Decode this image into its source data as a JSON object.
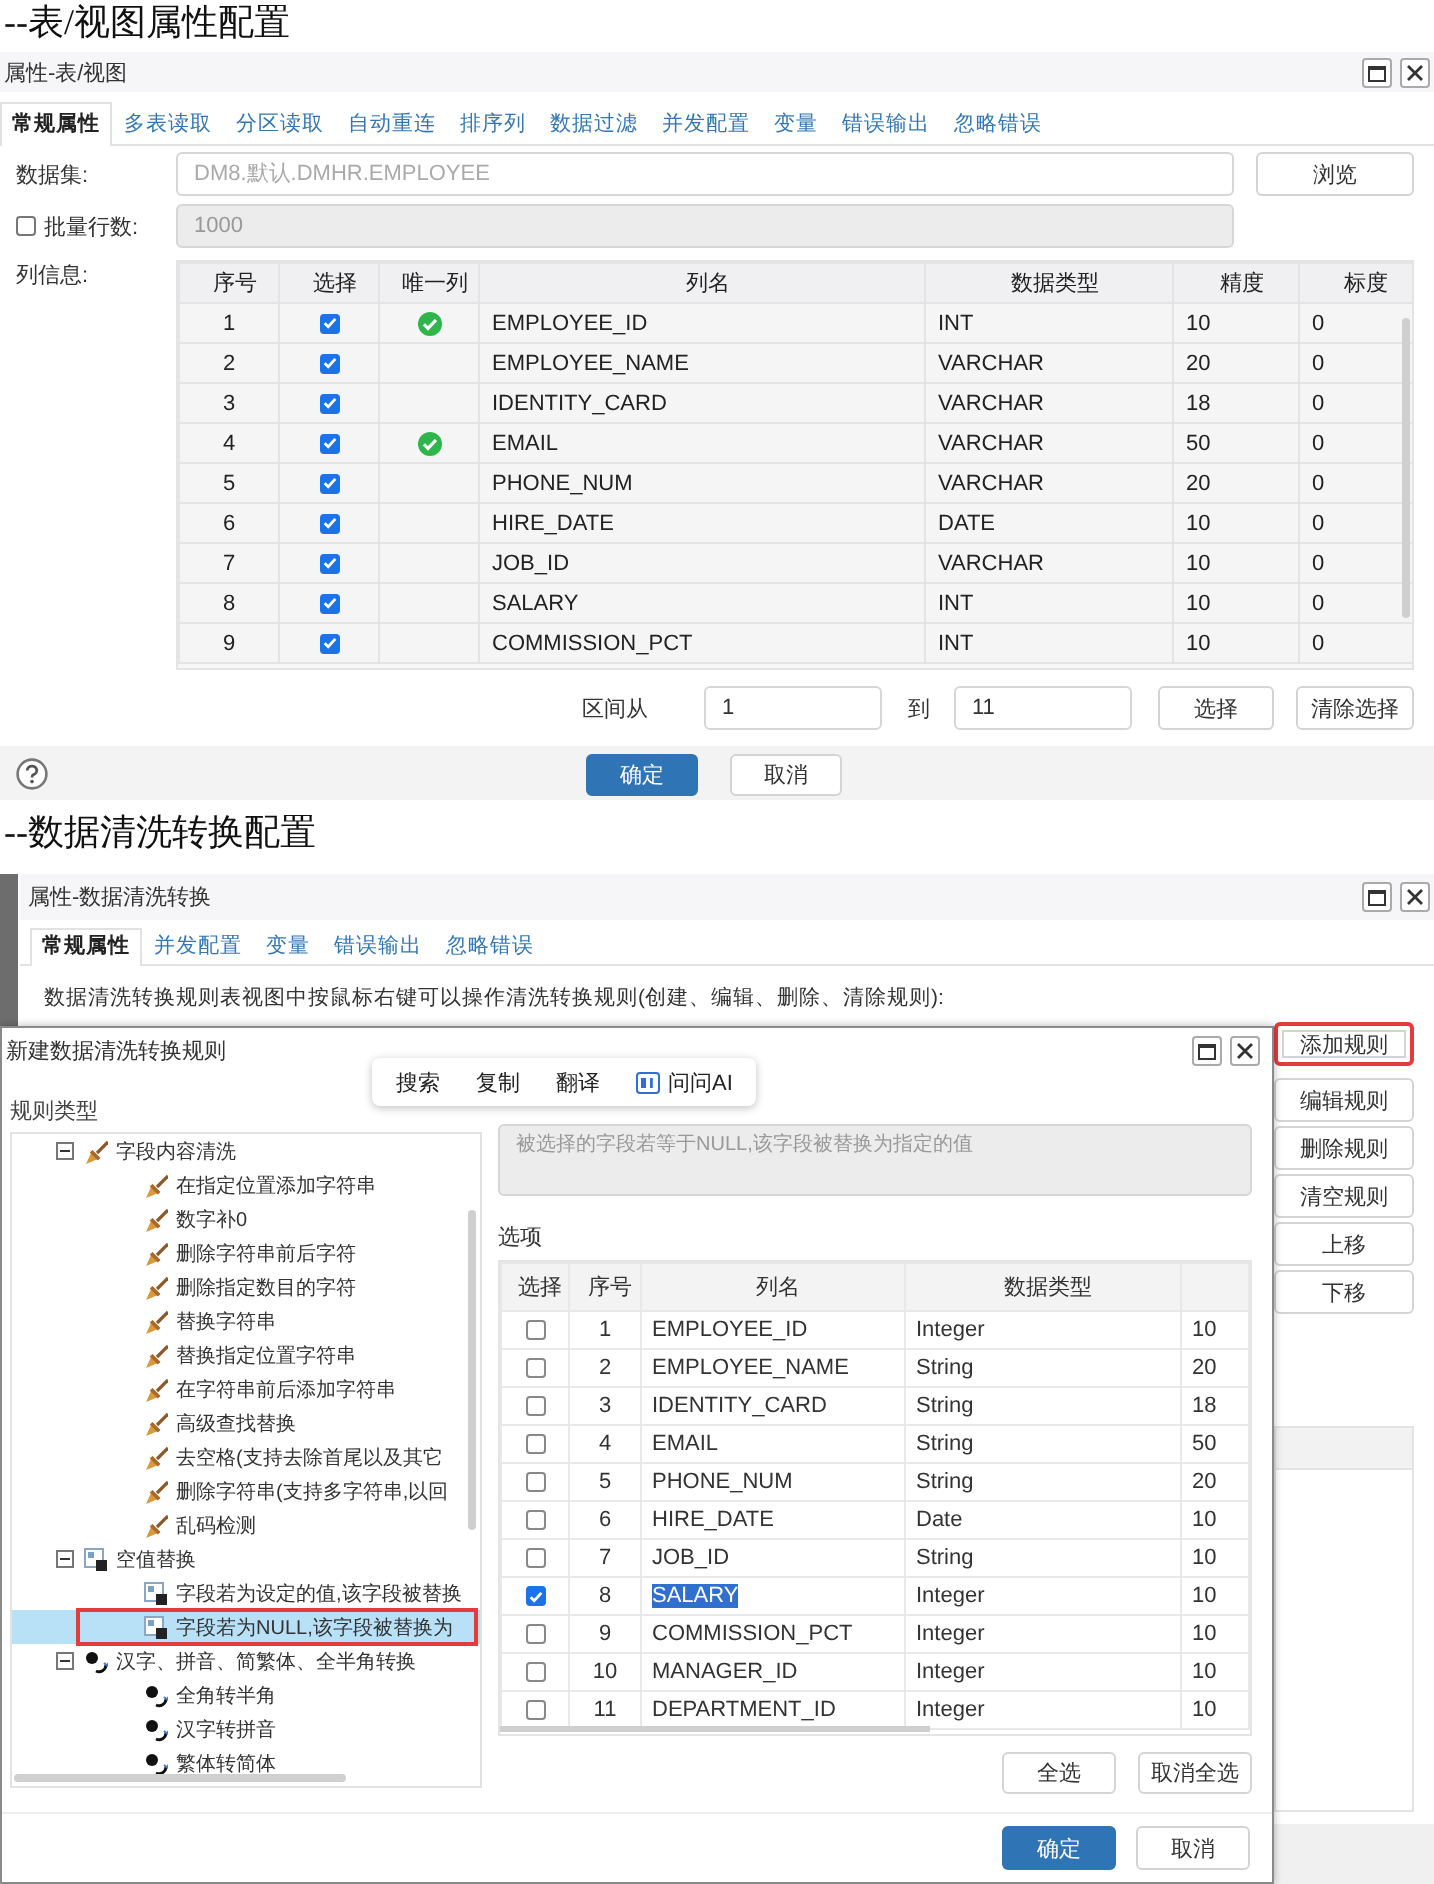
{
  "heading_1": "--表/视图属性配置",
  "table_view_dialog": {
    "title": "属性-表/视图",
    "tabs": [
      {
        "label": "常规属性",
        "selected": true
      },
      {
        "label": "多表读取",
        "selected": false
      },
      {
        "label": "分区读取",
        "selected": false
      },
      {
        "label": "自动重连",
        "selected": false
      },
      {
        "label": "排序列",
        "selected": false
      },
      {
        "label": "数据过滤",
        "selected": false
      },
      {
        "label": "并发配置",
        "selected": false
      },
      {
        "label": "变量",
        "selected": false
      },
      {
        "label": "错误输出",
        "selected": false
      },
      {
        "label": "忽略错误",
        "selected": false
      }
    ],
    "dataset": {
      "label": "数据集:",
      "value": "DM8.默认.DMHR.EMPLOYEE"
    },
    "browse_button": "浏览",
    "batch_rows": {
      "label": "批量行数:",
      "checked": false,
      "value": "1000",
      "disabled": true
    },
    "columns_label": "列信息:",
    "table": {
      "columns": [
        "序号",
        "选择",
        "唯一列",
        "列名",
        "数据类型",
        "精度",
        "标度"
      ],
      "rows": [
        {
          "no": "1",
          "checked": true,
          "unique": true,
          "name": "EMPLOYEE_ID",
          "type": "INT",
          "precision": "10",
          "scale": "0"
        },
        {
          "no": "2",
          "checked": true,
          "unique": false,
          "name": "EMPLOYEE_NAME",
          "type": "VARCHAR",
          "precision": "20",
          "scale": "0"
        },
        {
          "no": "3",
          "checked": true,
          "unique": false,
          "name": "IDENTITY_CARD",
          "type": "VARCHAR",
          "precision": "18",
          "scale": "0"
        },
        {
          "no": "4",
          "checked": true,
          "unique": true,
          "name": "EMAIL",
          "type": "VARCHAR",
          "precision": "50",
          "scale": "0"
        },
        {
          "no": "5",
          "checked": true,
          "unique": false,
          "name": "PHONE_NUM",
          "type": "VARCHAR",
          "precision": "20",
          "scale": "0"
        },
        {
          "no": "6",
          "checked": true,
          "unique": false,
          "name": "HIRE_DATE",
          "type": "DATE",
          "precision": "10",
          "scale": "0"
        },
        {
          "no": "7",
          "checked": true,
          "unique": false,
          "name": "JOB_ID",
          "type": "VARCHAR",
          "precision": "10",
          "scale": "0"
        },
        {
          "no": "8",
          "checked": true,
          "unique": false,
          "name": "SALARY",
          "type": "INT",
          "precision": "10",
          "scale": "0"
        },
        {
          "no": "9",
          "checked": true,
          "unique": false,
          "name": "COMMISSION_PCT",
          "type": "INT",
          "precision": "10",
          "scale": "0"
        }
      ]
    },
    "range": {
      "from_label": "区间从",
      "from": "1",
      "to_label": "到",
      "to": "11",
      "select_button": "选择",
      "clear_button": "清除选择"
    },
    "buttons": [
      {
        "label": "确定",
        "kind": "primary"
      },
      {
        "label": "取消",
        "kind": "normal"
      }
    ]
  },
  "heading_2": "--数据清洗转换配置",
  "cleansing_dialog": {
    "title": "属性-数据清洗转换",
    "tabs": [
      {
        "label": "常规属性",
        "selected": true
      },
      {
        "label": "并发配置",
        "selected": false
      },
      {
        "label": "变量",
        "selected": false
      },
      {
        "label": "错误输出",
        "selected": false
      },
      {
        "label": "忽略错误",
        "selected": false
      }
    ],
    "description": "数据清洗转换规则表视图中按鼠标右键可以操作清洗转换规则(创建、编辑、删除、清除规则):",
    "rule_buttons": [
      {
        "label": "添加规则",
        "highlighted": true
      },
      {
        "label": "编辑规则",
        "highlighted": false
      },
      {
        "label": "删除规则",
        "highlighted": false
      },
      {
        "label": "清空规则",
        "highlighted": false
      },
      {
        "label": "上移",
        "highlighted": false
      },
      {
        "label": "下移",
        "highlighted": false
      }
    ]
  },
  "new_rule_dialog": {
    "title": "新建数据清洗转换规则",
    "rule_type_label": "规则类型",
    "tree": [
      {
        "label": "字段内容清洗",
        "kind": "broom",
        "expanded": true,
        "selected": false,
        "highlighted": false,
        "children": [
          {
            "label": "在指定位置添加字符串",
            "kind": "broom",
            "selected": false,
            "highlighted": false
          },
          {
            "label": "数字补0",
            "kind": "broom",
            "selected": false,
            "highlighted": false
          },
          {
            "label": "删除字符串前后字符",
            "kind": "broom",
            "selected": false,
            "highlighted": false
          },
          {
            "label": "删除指定数目的字符",
            "kind": "broom",
            "selected": false,
            "highlighted": false
          },
          {
            "label": "替换字符串",
            "kind": "broom",
            "selected": false,
            "highlighted": false
          },
          {
            "label": "替换指定位置字符串",
            "kind": "broom",
            "selected": false,
            "highlighted": false
          },
          {
            "label": "在字符串前后添加字符串",
            "kind": "broom",
            "selected": false,
            "highlighted": false
          },
          {
            "label": "高级查找替换",
            "kind": "broom",
            "selected": false,
            "highlighted": false
          },
          {
            "label": "去空格(支持去除首尾以及其它",
            "kind": "broom",
            "selected": false,
            "highlighted": false
          },
          {
            "label": "删除字符串(支持多字符串,以回",
            "kind": "broom",
            "selected": false,
            "highlighted": false
          },
          {
            "label": "乱码检测",
            "kind": "broom",
            "selected": false,
            "highlighted": false
          }
        ]
      },
      {
        "label": "空值替换",
        "kind": "null",
        "expanded": true,
        "selected": false,
        "highlighted": false,
        "children": [
          {
            "label": "字段若为设定的值,该字段被替换",
            "kind": "null",
            "selected": false,
            "highlighted": false
          },
          {
            "label": "字段若为NULL,该字段被替换为",
            "kind": "null",
            "selected": true,
            "highlighted": true
          }
        ]
      },
      {
        "label": "汉字、拼音、简繁体、全半角转换",
        "kind": "convert",
        "expanded": true,
        "selected": false,
        "highlighted": false,
        "children": [
          {
            "label": "全角转半角",
            "kind": "convert",
            "selected": false,
            "highlighted": false
          },
          {
            "label": "汉字转拼音",
            "kind": "convert",
            "selected": false,
            "highlighted": false
          },
          {
            "label": "繁体转简体",
            "kind": "convert",
            "selected": false,
            "highlighted": false
          }
        ]
      }
    ],
    "description": {
      "value": "被选择的字段若等于NULL,该字段被替换为指定的值"
    },
    "options_label": "选项",
    "table": {
      "columns": [
        "选择",
        "序号",
        "列名",
        "数据类型"
      ],
      "rows": [
        {
          "checked": false,
          "no": "1",
          "name": "EMPLOYEE_ID",
          "name_selected": false,
          "type": "Integer",
          "column_5": "10"
        },
        {
          "checked": false,
          "no": "2",
          "name": "EMPLOYEE_NAME",
          "name_selected": false,
          "type": "String",
          "column_5": "20"
        },
        {
          "checked": false,
          "no": "3",
          "name": "IDENTITY_CARD",
          "name_selected": false,
          "type": "String",
          "column_5": "18"
        },
        {
          "checked": false,
          "no": "4",
          "name": "EMAIL",
          "name_selected": false,
          "type": "String",
          "column_5": "50"
        },
        {
          "checked": false,
          "no": "5",
          "name": "PHONE_NUM",
          "name_selected": false,
          "type": "String",
          "column_5": "20"
        },
        {
          "checked": false,
          "no": "6",
          "name": "HIRE_DATE",
          "name_selected": false,
          "type": "Date",
          "column_5": "10"
        },
        {
          "checked": false,
          "no": "7",
          "name": "JOB_ID",
          "name_selected": false,
          "type": "String",
          "column_5": "10"
        },
        {
          "checked": true,
          "no": "8",
          "name": "SALARY",
          "name_selected": true,
          "type": "Integer",
          "column_5": "10"
        },
        {
          "checked": false,
          "no": "9",
          "name": "COMMISSION_PCT",
          "name_selected": false,
          "type": "Integer",
          "column_5": "10"
        },
        {
          "checked": false,
          "no": "10",
          "name": "MANAGER_ID",
          "name_selected": false,
          "type": "Integer",
          "column_5": "10"
        },
        {
          "checked": false,
          "no": "11",
          "name": "DEPARTMENT_ID",
          "name_selected": false,
          "type": "Integer",
          "column_5": "10"
        }
      ]
    },
    "select_all": "全选",
    "deselect_all": "取消全选",
    "buttons": [
      {
        "label": "确定",
        "kind": "primary"
      },
      {
        "label": "取消",
        "kind": "normal"
      }
    ]
  },
  "context_toolbar": {
    "items": [
      {
        "label": "搜索",
        "kind": "text"
      },
      {
        "label": "复制",
        "kind": "text"
      },
      {
        "label": "翻译",
        "kind": "text"
      },
      {
        "label": "问问AI",
        "kind": "ai"
      }
    ]
  }
}
